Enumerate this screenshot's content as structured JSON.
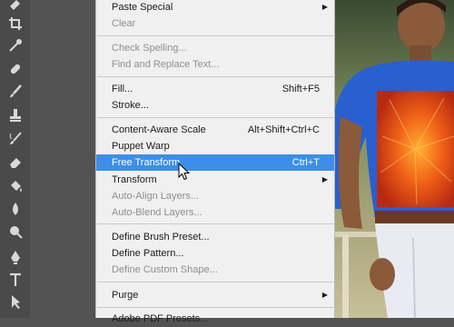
{
  "menu": {
    "items": [
      {
        "label": "Paste Special",
        "shortcut": "",
        "submenu": true,
        "disabled": false
      },
      {
        "label": "Clear",
        "shortcut": "",
        "submenu": false,
        "disabled": true
      },
      {
        "label": "Check Spelling...",
        "shortcut": "",
        "submenu": false,
        "disabled": true
      },
      {
        "label": "Find and Replace Text...",
        "shortcut": "",
        "submenu": false,
        "disabled": true
      },
      {
        "label": "Fill...",
        "shortcut": "Shift+F5",
        "submenu": false,
        "disabled": false
      },
      {
        "label": "Stroke...",
        "shortcut": "",
        "submenu": false,
        "disabled": false
      },
      {
        "label": "Content-Aware Scale",
        "shortcut": "Alt+Shift+Ctrl+C",
        "submenu": false,
        "disabled": false
      },
      {
        "label": "Puppet Warp",
        "shortcut": "",
        "submenu": false,
        "disabled": false
      },
      {
        "label": "Free Transform",
        "shortcut": "Ctrl+T",
        "submenu": false,
        "disabled": false,
        "highlighted": true
      },
      {
        "label": "Transform",
        "shortcut": "",
        "submenu": true,
        "disabled": false
      },
      {
        "label": "Auto-Align Layers...",
        "shortcut": "",
        "submenu": false,
        "disabled": true
      },
      {
        "label": "Auto-Blend Layers...",
        "shortcut": "",
        "submenu": false,
        "disabled": true
      },
      {
        "label": "Define Brush Preset...",
        "shortcut": "",
        "submenu": false,
        "disabled": false
      },
      {
        "label": "Define Pattern...",
        "shortcut": "",
        "submenu": false,
        "disabled": false
      },
      {
        "label": "Define Custom Shape...",
        "shortcut": "",
        "submenu": false,
        "disabled": true
      },
      {
        "label": "Purge",
        "shortcut": "",
        "submenu": true,
        "disabled": false
      },
      {
        "label": "Adobe PDF Presets...",
        "shortcut": "",
        "submenu": false,
        "disabled": false
      }
    ]
  },
  "toolbar": {
    "tools": [
      "eraser-icon",
      "crop-icon",
      "eyedropper-icon",
      "healing-brush-icon",
      "brush-icon",
      "clone-stamp-icon",
      "history-brush-icon",
      "eraser-tool-icon",
      "paint-bucket-icon",
      "blur-icon",
      "dodge-icon",
      "pen-icon",
      "type-icon",
      "path-selection-icon"
    ]
  },
  "colors": {
    "highlight": "#3d8ee6",
    "menu_bg": "#f0f0f0",
    "toolbar_bg": "#4a4a4a",
    "shirt": "#2a5fd0",
    "flower": "#e8501a"
  }
}
